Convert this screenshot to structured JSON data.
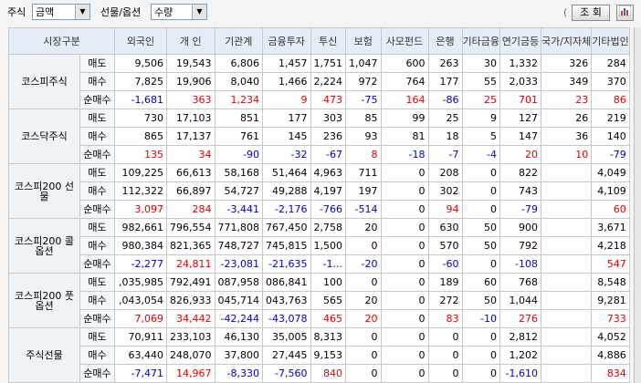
{
  "toolbar": {
    "stock_label": "주식",
    "stock_value": "금액",
    "futopt_label": "선물/옵션",
    "futopt_value": "수량",
    "unit_prefix": "(",
    "query_button": "조 회",
    "chart_icon": "chart-icon"
  },
  "columns": [
    "시장구분",
    "",
    "외국인",
    "개 인",
    "기관계",
    "금융투자",
    "투신",
    "보험",
    "사모펀드",
    "은행",
    "기타금융",
    "연기금등",
    "국가/지자체",
    "기타법인"
  ],
  "groups": [
    {
      "name": "코스피주식",
      "rows": [
        {
          "type": "매도",
          "vals": [
            "9,506",
            "19,543",
            "6,806",
            "1,457",
            "1,751",
            "1,047",
            "600",
            "263",
            "30",
            "1,332",
            "326",
            "284"
          ]
        },
        {
          "type": "매수",
          "vals": [
            "7,825",
            "19,906",
            "8,040",
            "1,466",
            "2,224",
            "972",
            "764",
            "177",
            "55",
            "2,033",
            "349",
            "370"
          ]
        },
        {
          "type": "순매수",
          "vals": [
            "-1,681",
            "363",
            "1,234",
            "9",
            "473",
            "-75",
            "164",
            "-86",
            "25",
            "701",
            "23",
            "86"
          ]
        }
      ]
    },
    {
      "name": "코스닥주식",
      "rows": [
        {
          "type": "매도",
          "vals": [
            "730",
            "17,103",
            "851",
            "177",
            "303",
            "85",
            "99",
            "25",
            "9",
            "127",
            "26",
            "219"
          ]
        },
        {
          "type": "매수",
          "vals": [
            "865",
            "17,137",
            "761",
            "145",
            "236",
            "93",
            "81",
            "18",
            "5",
            "147",
            "36",
            "140"
          ]
        },
        {
          "type": "순매수",
          "vals": [
            "135",
            "34",
            "-90",
            "-32",
            "-67",
            "8",
            "-18",
            "-7",
            "-4",
            "20",
            "10",
            "-79"
          ]
        }
      ]
    },
    {
      "name": "코스피200 선물",
      "rows": [
        {
          "type": "매도",
          "vals": [
            "109,225",
            "66,613",
            "58,168",
            "51,464",
            "4,963",
            "711",
            "0",
            "208",
            "0",
            "822",
            "",
            "4,049"
          ]
        },
        {
          "type": "매수",
          "vals": [
            "112,322",
            "66,897",
            "54,727",
            "49,288",
            "4,197",
            "197",
            "0",
            "302",
            "0",
            "743",
            "",
            "4,109"
          ]
        },
        {
          "type": "순매수",
          "vals": [
            "3,097",
            "284",
            "-3,441",
            "-2,176",
            "-766",
            "-514",
            "0",
            "94",
            "0",
            "-79",
            "",
            "60"
          ]
        }
      ]
    },
    {
      "name": "코스피200 콜옵션",
      "rows": [
        {
          "type": "매도",
          "vals": [
            "982,661",
            "796,554",
            "771,808",
            "767,450",
            "2,758",
            "20",
            "0",
            "630",
            "50",
            "900",
            "",
            "3,671"
          ]
        },
        {
          "type": "매수",
          "vals": [
            "980,384",
            "821,365",
            "748,727",
            "745,815",
            "1,500",
            "0",
            "0",
            "570",
            "50",
            "792",
            "",
            "4,218"
          ]
        },
        {
          "type": "순매수",
          "vals": [
            "-2,277",
            "24,811",
            "-23,081",
            "-21,635",
            "-1...",
            "-20",
            "0",
            "-60",
            "0",
            "-108",
            "",
            "547"
          ]
        }
      ]
    },
    {
      "name": "코스피200 풋옵션",
      "rows": [
        {
          "type": "매도",
          "vals": [
            ",035,985",
            "792,491",
            "087,958",
            "086,841",
            "100",
            "0",
            "0",
            "189",
            "60",
            "768",
            "",
            "8,548"
          ]
        },
        {
          "type": "매수",
          "vals": [
            ",043,054",
            "826,933",
            "045,714",
            "043,763",
            "565",
            "20",
            "0",
            "272",
            "50",
            "1,044",
            "",
            "9,281"
          ]
        },
        {
          "type": "순매수",
          "vals": [
            "7,069",
            "34,442",
            "-42,244",
            "-43,078",
            "465",
            "20",
            "0",
            "83",
            "-10",
            "276",
            "",
            "733"
          ]
        }
      ]
    },
    {
      "name": "주식선물",
      "rows": [
        {
          "type": "매도",
          "vals": [
            "70,911",
            "233,103",
            "46,130",
            "35,005",
            "8,313",
            "0",
            "0",
            "0",
            "0",
            "2,812",
            "",
            "4,052"
          ]
        },
        {
          "type": "매수",
          "vals": [
            "63,440",
            "248,070",
            "37,800",
            "27,445",
            "9,153",
            "0",
            "0",
            "0",
            "0",
            "1,202",
            "",
            "4,886"
          ]
        },
        {
          "type": "순매수",
          "vals": [
            "-7,471",
            "14,967",
            "-8,330",
            "-7,560",
            "840",
            "0",
            "0",
            "0",
            "0",
            "-1,610",
            "",
            "834"
          ]
        }
      ]
    }
  ],
  "colors": {
    "positive": "#e00000",
    "negative": "#0000cc",
    "header_bg": "#e4edf5"
  }
}
